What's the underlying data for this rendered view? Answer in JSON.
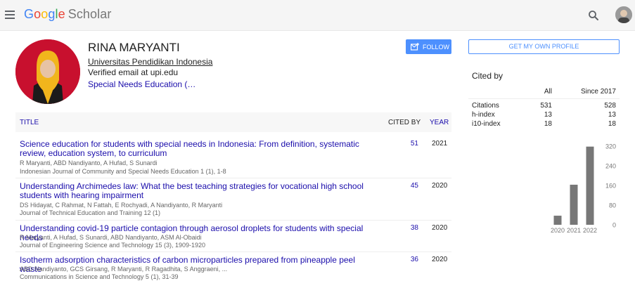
{
  "header": {
    "logo_g": "G",
    "logo_o1": "o",
    "logo_o2": "o",
    "logo_g2": "g",
    "logo_l": "l",
    "logo_e": "e",
    "logo_scholar": "Scholar"
  },
  "profile": {
    "name": "RINA MARYANTI",
    "affiliation": "Universitas Pendidikan Indonesia",
    "email": "Verified email at upi.edu",
    "interest": "Special Needs Education (…",
    "follow_label": "FOLLOW"
  },
  "table": {
    "col_title": "TITLE",
    "col_cited": "CITED BY",
    "col_year": "YEAR",
    "rows": [
      {
        "title": "Science education for students with special needs in Indonesia: From definition, systematic review, education system, to curriculum",
        "authors": "R Maryanti, ABD Nandiyanto, A Hufad, S Sunardi",
        "journal": "Indonesian Journal of Community and Special Needs Education 1 (1), 1-8",
        "cited": "51",
        "year": "2021"
      },
      {
        "title": "Understanding Archimedes law: What the best teaching strategies for vocational high school students with hearing impairment",
        "authors": "DS Hidayat, C Rahmat, N Fattah, E Rochyadi, A Nandiyanto, R Maryanti",
        "journal": "Journal of Technical Education and Training 12 (1)",
        "cited": "45",
        "year": "2020"
      },
      {
        "title": "Understanding covid-19 particle contagion through aerosol droplets for students with special needs",
        "authors": "R Maryanti, A Hufad, S Sunardi, ABD Nandiyanto, ASM Al-Obaidi",
        "journal": "Journal of Engineering Science and Technology 15 (3), 1909-1920",
        "cited": "38",
        "year": "2020"
      },
      {
        "title": "Isotherm adsorption characteristics of carbon microparticles prepared from pineapple peel waste",
        "authors": "ABD Nandiyanto, GCS Girsang, R Maryanti, R Ragadhita, S Anggraeni, ...",
        "journal": "Communications in Science and Technology 5 (1), 31-39",
        "cited": "36",
        "year": "2020"
      }
    ]
  },
  "sidebar": {
    "own_profile_label": "GET MY OWN PROFILE",
    "cited_by_title": "Cited by",
    "col_all": "All",
    "col_since": "Since 2017",
    "metrics": [
      {
        "label": "Citations",
        "all": "531",
        "since": "528"
      },
      {
        "label": "h-index",
        "all": "13",
        "since": "13"
      },
      {
        "label": "i10-index",
        "all": "18",
        "since": "18"
      }
    ]
  },
  "chart_data": {
    "type": "bar",
    "categories": [
      "2020",
      "2021",
      "2022"
    ],
    "values": [
      37,
      163,
      318
    ],
    "yticks": [
      0,
      80,
      160,
      240,
      320
    ],
    "ylim": [
      0,
      320
    ]
  }
}
